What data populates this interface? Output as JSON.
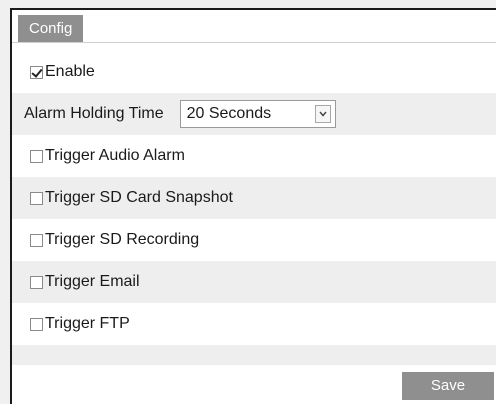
{
  "tabs": [
    {
      "label": "Config",
      "active": true
    }
  ],
  "enable": {
    "label": "Enable",
    "checked": true
  },
  "alarm_holding_time": {
    "label": "Alarm Holding Time",
    "value": "20 Seconds"
  },
  "triggers": [
    {
      "label": "Trigger Audio Alarm",
      "checked": false
    },
    {
      "label": "Trigger SD Card Snapshot",
      "checked": false
    },
    {
      "label": "Trigger SD Recording",
      "checked": false
    },
    {
      "label": "Trigger Email",
      "checked": false
    },
    {
      "label": "Trigger FTP",
      "checked": false
    }
  ],
  "save_label": "Save",
  "colors": {
    "tab_bg": "#8f8f8f",
    "row_shade": "#eeeeee",
    "button_bg": "#8f8f8f"
  }
}
